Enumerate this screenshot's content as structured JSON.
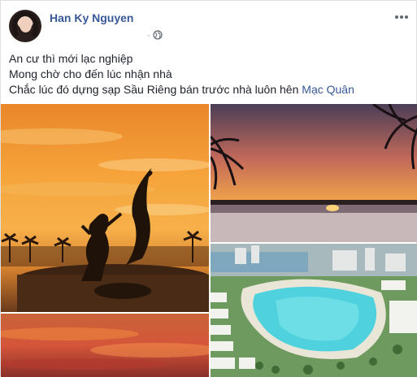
{
  "post": {
    "author": "Han Ky Nguyen",
    "meta_dot": "·",
    "privacy_icon": "globe-icon",
    "more_icon": "more-options-icon",
    "lines": [
      "An cư thì mới lạc nghiệp",
      "Mong chờ cho đến lúc nhận nhà",
      "Chắc lúc đó dựng sạp Sầu Riêng bán trước nhà luôn hên "
    ],
    "mention": "Mạc Quân"
  },
  "colors": {
    "author": "#385898",
    "text": "#1d2129",
    "meta": "#90949c"
  }
}
